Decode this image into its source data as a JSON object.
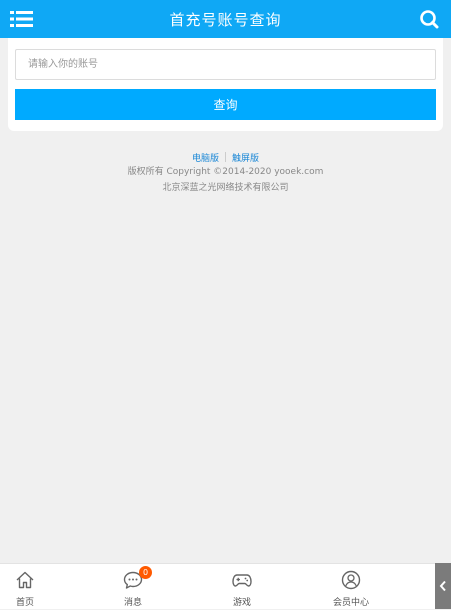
{
  "header": {
    "title": "首充号账号查询",
    "menu_icon": "menu-icon",
    "search_icon": "search-icon"
  },
  "form": {
    "account_placeholder": "请输入你的账号",
    "account_value": "",
    "query_label": "查询"
  },
  "footer": {
    "pc_link": "电脑版",
    "touch_link": "触屏版",
    "copyright": "版权所有 Copyright ©2014-2020 yooek.com",
    "company": "北京深蓝之光网络技术有限公司"
  },
  "bottom_nav": {
    "items": [
      {
        "label": "首页",
        "icon": "home-icon"
      },
      {
        "label": "消息",
        "icon": "message-icon",
        "badge": "0"
      },
      {
        "label": "游戏",
        "icon": "gamepad-icon"
      },
      {
        "label": "会员中心",
        "icon": "user-icon"
      }
    ]
  },
  "colors": {
    "header_bg": "#0fa8f5",
    "button_bg": "#00aaff",
    "badge_bg": "#ff5a00",
    "link": "#1a87d6"
  }
}
